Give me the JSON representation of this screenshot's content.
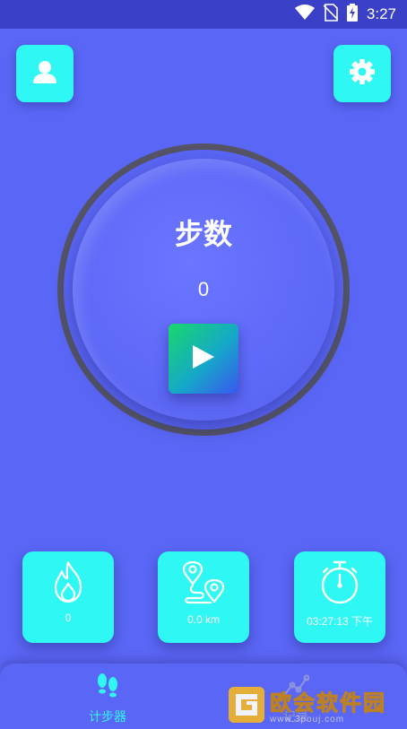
{
  "status_bar": {
    "time": "3:27",
    "icons": [
      "wifi-icon",
      "no-sim-icon",
      "battery-charging-icon"
    ]
  },
  "header": {
    "profile_icon": "person-icon",
    "settings_icon": "gear-icon"
  },
  "main": {
    "title": "步数",
    "step_count": "0",
    "play_icon": "play-icon"
  },
  "stats": [
    {
      "icon": "flame-icon",
      "value": "0"
    },
    {
      "icon": "route-icon",
      "value": "0.0 km"
    },
    {
      "icon": "stopwatch-icon",
      "value": "03:27:13 下午"
    }
  ],
  "nav": {
    "items": [
      {
        "icon": "footprints-icon",
        "label": "计步器"
      },
      {
        "icon": "chart-icon",
        "label": "记录"
      }
    ]
  },
  "watermark": {
    "main": "欧会软件园",
    "sub": "www.3pouj.com"
  },
  "colors": {
    "background": "#5a66f5",
    "accent": "#2ff7f4",
    "ring": "#545466",
    "watermark": "#f4b93a"
  }
}
